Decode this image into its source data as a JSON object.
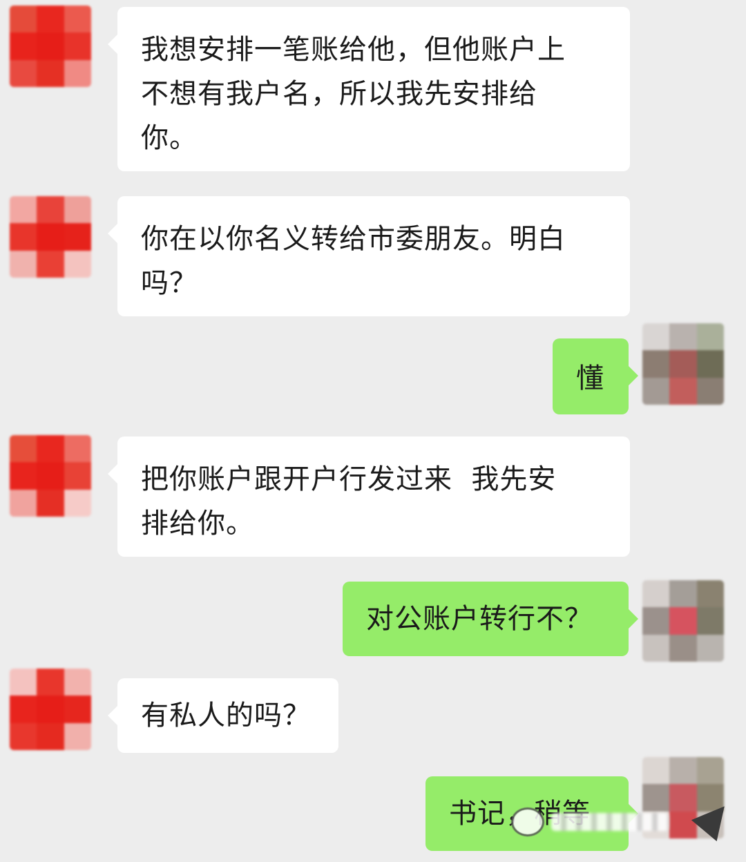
{
  "messages": [
    {
      "side": "left",
      "text": "我想安排一笔账给他，但他账户上\n不想有我户名，所以我先安排给\n你。"
    },
    {
      "side": "left",
      "text": "你在以你名义转给市委朋友。明白\n吗？"
    },
    {
      "side": "right",
      "text": "懂"
    },
    {
      "side": "left",
      "text": "把你账户跟开户行发过来  我先安\n排给你。"
    },
    {
      "side": "right",
      "text": "对公账户转行不？"
    },
    {
      "side": "left",
      "text": "有私人的吗？"
    },
    {
      "side": "right",
      "text": "书记，稍等"
    }
  ],
  "colors": {
    "background": "#ededed",
    "incoming_bubble": "#ffffff",
    "outgoing_bubble": "#95ec69",
    "text": "#1a1a1a"
  },
  "icons": {
    "left_avatar": "mosaic-avatar-red",
    "right_avatar": "mosaic-avatar-gray",
    "watermark": "wechat-logo-icon"
  }
}
